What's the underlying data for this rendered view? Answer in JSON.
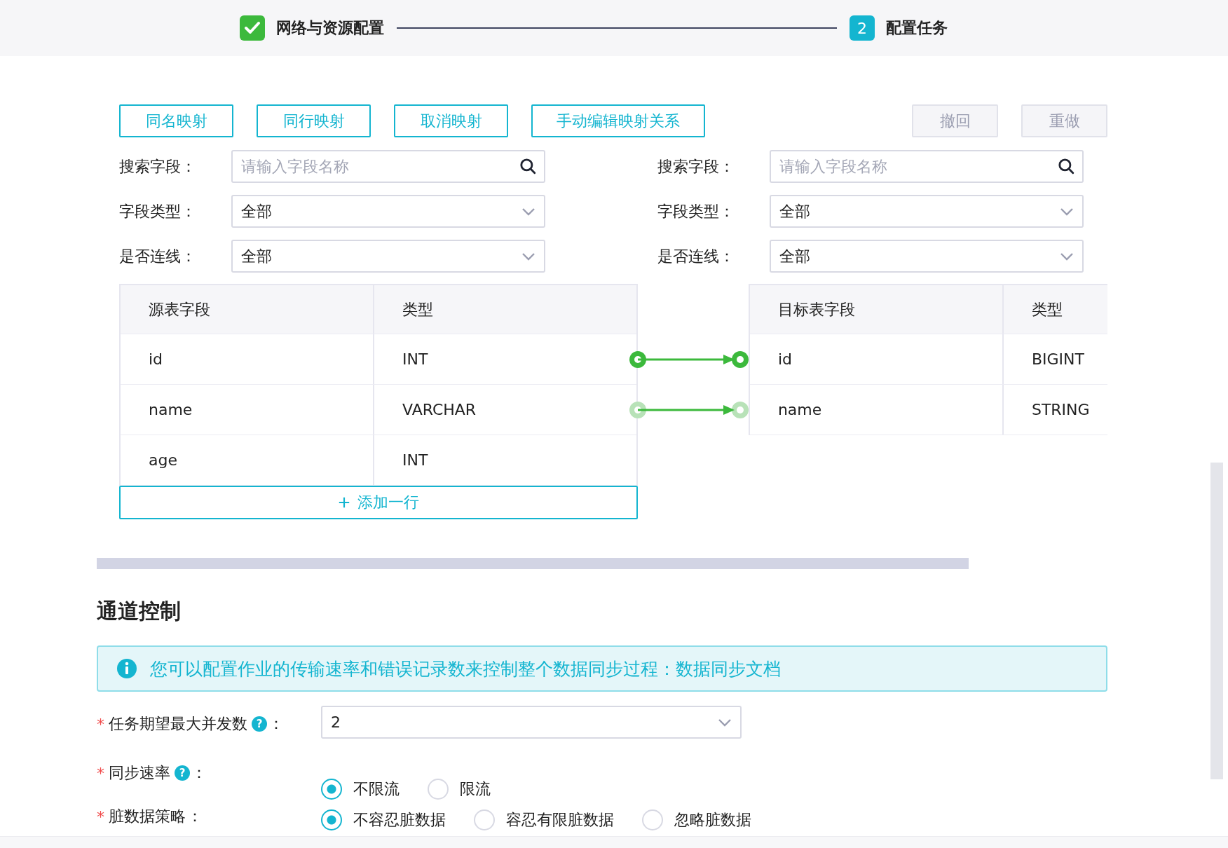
{
  "steps": [
    {
      "label": "网络与资源配置",
      "completed": true
    },
    {
      "label": "配置任务",
      "number": "2",
      "completed": false
    }
  ],
  "mapping_buttons": [
    "同名映射",
    "同行映射",
    "取消映射",
    "手动编辑映射关系"
  ],
  "history_buttons": [
    {
      "label": "撤回",
      "disabled": true
    },
    {
      "label": "重做",
      "disabled": true
    }
  ],
  "filters": [
    {
      "search": {
        "label": "搜索字段：",
        "placeholder": "请输入字段名称"
      },
      "type": {
        "label": "字段类型：",
        "value": "全部"
      },
      "linked": {
        "label": "是否连线：",
        "value": "全部"
      }
    },
    {
      "search": {
        "label": "搜索字段：",
        "placeholder": "请输入字段名称"
      },
      "type": {
        "label": "字段类型：",
        "value": "全部"
      },
      "linked": {
        "label": "是否连线：",
        "value": "全部"
      }
    }
  ],
  "source_table": {
    "columns": [
      "源表字段",
      "类型"
    ],
    "rows": [
      {
        "field": "id",
        "type": "INT",
        "linked": true,
        "link_active": true
      },
      {
        "field": "name",
        "type": "VARCHAR",
        "linked": true,
        "link_active": false
      },
      {
        "field": "age",
        "type": "INT",
        "linked": false
      }
    ],
    "add_row": "添加一行"
  },
  "target_table": {
    "columns": [
      "目标表字段",
      "类型"
    ],
    "rows": [
      {
        "field": "id",
        "type": "BIGINT"
      },
      {
        "field": "name",
        "type": "STRING"
      }
    ]
  },
  "section_title": "通道控制",
  "info": {
    "text": "您可以配置作业的传输速率和错误记录数来控制整个数据同步过程：",
    "link": "数据同步文档"
  },
  "form": [
    {
      "kind": "select",
      "required_mark": "*",
      "label": "任务期望最大并发数",
      "help": "?",
      "colon": "：",
      "value": "2"
    },
    {
      "kind": "radio",
      "required_mark": "*",
      "label": "同步速率",
      "help": "?",
      "colon": "：",
      "options": [
        {
          "label": "不限流",
          "selected": true
        },
        {
          "label": "限流",
          "selected": false
        }
      ]
    },
    {
      "kind": "radio",
      "required_mark": "*",
      "label": "脏数据策略",
      "colon": "：",
      "options": [
        {
          "label": "不容忍脏数据",
          "selected": true
        },
        {
          "label": "容忍有限脏数据",
          "selected": false
        },
        {
          "label": "忽略脏数据",
          "selected": false
        }
      ]
    }
  ]
}
